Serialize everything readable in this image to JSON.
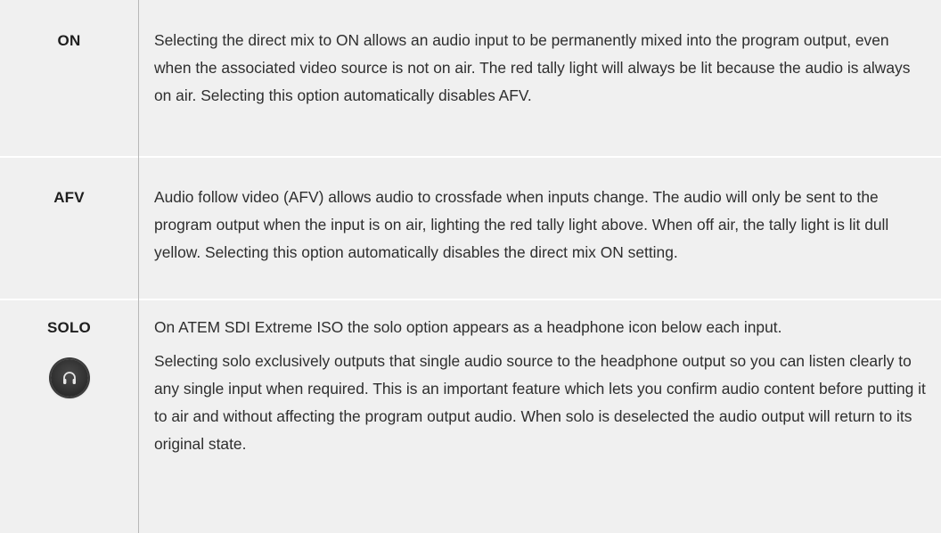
{
  "rows": [
    {
      "term": "ON",
      "paragraphs": [
        "Selecting the direct mix to ON allows an audio input to be permanently mixed into the program output, even when the associated video source is not on air. The red tally light will always be lit because the audio is always on air. Selecting this option automatically disables AFV."
      ]
    },
    {
      "term": "AFV",
      "paragraphs": [
        "Audio follow video (AFV) allows audio to crossfade when inputs change. The audio will only be sent to the program output when the input is on air, lighting the red tally light above. When off air, the tally light is lit dull yellow. Selecting this option automatically disables the direct mix ON setting."
      ]
    },
    {
      "term": "SOLO",
      "icon": "headphone-icon",
      "paragraphs": [
        "On ATEM SDI Extreme ISO the solo option appears as a headphone icon below each input.",
        "Selecting solo exclusively outputs that single audio source to the headphone output so you can listen clearly to any single input when required. This is an important feature which lets you confirm audio content before putting it to air and without affecting the program output audio. When solo is deselected the audio output will return to its original state."
      ]
    }
  ]
}
